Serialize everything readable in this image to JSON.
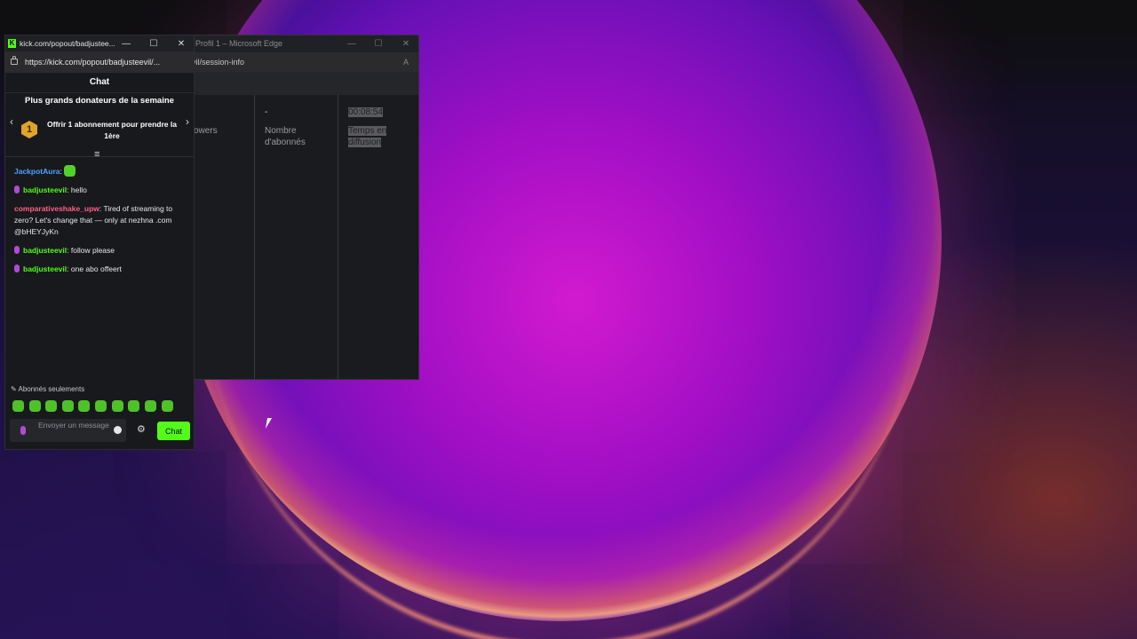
{
  "edge_window": {
    "title": "Profil 1 – Microsoft Edge",
    "url_fragment": "vil/session-info",
    "read_aloud_icon": "read-aloud-icon",
    "stats": [
      {
        "value": "",
        "label": "owers"
      },
      {
        "value": "-",
        "label": "Nombre d'abonnés"
      },
      {
        "value": "00:08:54",
        "label": "Temps en diffusion"
      }
    ]
  },
  "chat_window": {
    "tab_title": "kick.com/popout/badjustee...",
    "url": "https://kick.com/popout/badjusteevil/...",
    "header": "Chat",
    "top_gifters": {
      "title": "Plus grands donateurs de la semaine",
      "rank": "1",
      "cta": "Offrir 1 abonnement pour prendre la 1ère"
    },
    "messages": [
      {
        "user": "JackpotAura",
        "text": "",
        "user_color": "#4aa3ff",
        "emote": true,
        "badge": false
      },
      {
        "user": "badjusteevil",
        "text": "hello",
        "user_color": "#53fc18",
        "emote": false,
        "badge": true
      },
      {
        "user": "comparativeshake_upw",
        "text": "Tired of streaming to zero? Let's change that — only at nezhna .com @bHEYJyKn",
        "user_color": "#ff5f8a",
        "emote": false,
        "badge": false
      },
      {
        "user": "badjusteevil",
        "text": "follow please",
        "user_color": "#53fc18",
        "emote": false,
        "badge": true
      },
      {
        "user": "badjusteevil",
        "text": "one abo offeert",
        "user_color": "#53fc18",
        "emote": false,
        "badge": true
      }
    ],
    "subs_only_label": "Abonnés seulements",
    "input_placeholder": "Envoyer un message",
    "send_label": "Chat"
  },
  "colors": {
    "accent": "#53fc18",
    "badge": "#b14bd6"
  }
}
